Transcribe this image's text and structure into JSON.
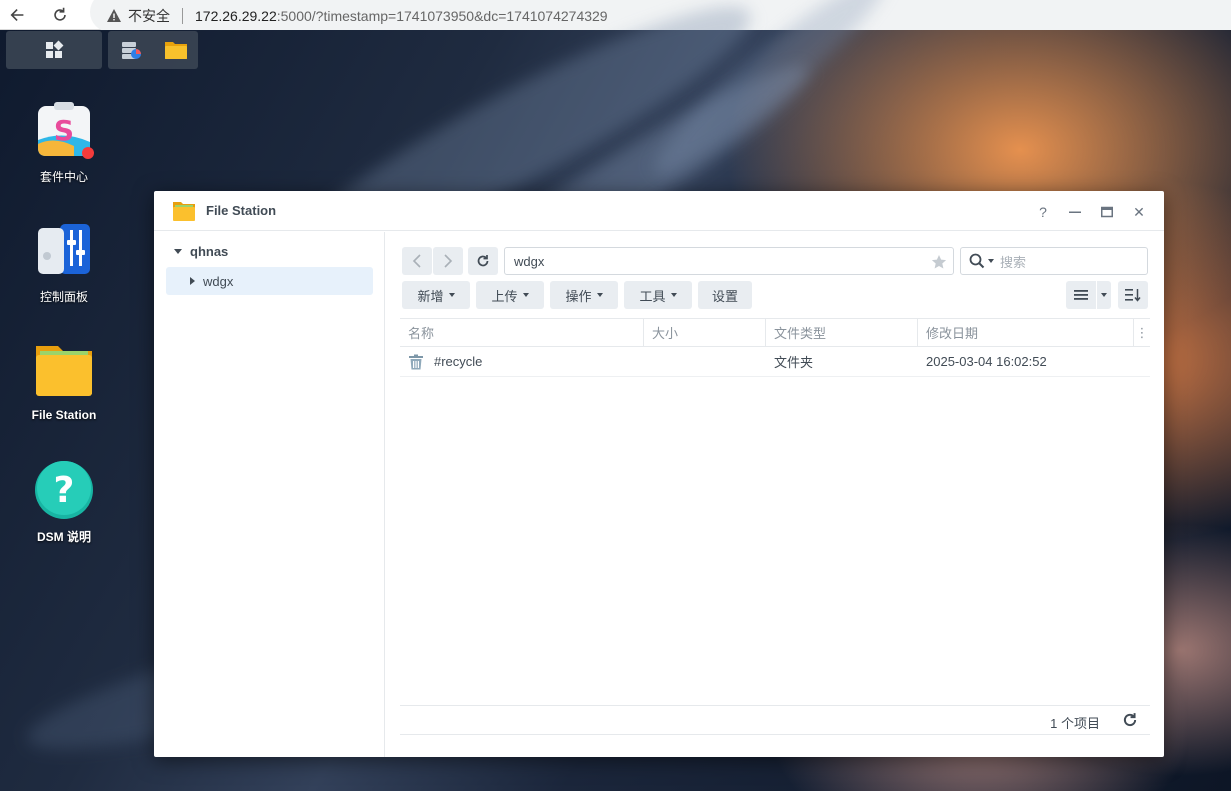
{
  "browser": {
    "back_icon": "arrow-left-icon",
    "reload_icon": "reload-icon",
    "security_label": "不安全",
    "url_host": "172.26.29.22",
    "url_rest": ":5000/?timestamp=1741073950&dc=1741074274329"
  },
  "desktop": {
    "icons": [
      {
        "label": "套件中心",
        "icon": "package-center-icon"
      },
      {
        "label": "控制面板",
        "icon": "control-panel-icon"
      },
      {
        "label": "File Station",
        "icon": "folder-icon"
      },
      {
        "label": "DSM 说明",
        "icon": "help-icon"
      }
    ]
  },
  "window": {
    "title": "File Station",
    "controls": [
      "help-icon",
      "minimize-icon",
      "maximize-icon",
      "close-icon"
    ],
    "help_glyph": "?",
    "close_glyph": "✕"
  },
  "sidebar": {
    "root": "qhnas",
    "child": "wdgx"
  },
  "toolbar": {
    "path": "wdgx",
    "search_placeholder": "搜索",
    "buttons": {
      "new": "新增",
      "upload": "上传",
      "action": "操作",
      "tools": "工具",
      "settings": "设置"
    }
  },
  "table": {
    "columns": [
      "名称",
      "大小",
      "文件类型",
      "修改日期"
    ],
    "rows": [
      {
        "name": "#recycle",
        "size": "",
        "type": "文件夹",
        "modified": "2025-03-04 16:02:52",
        "icon": "trash-icon"
      }
    ]
  },
  "footer": {
    "count": "1 个项目"
  },
  "colors": {
    "accent": "#0086e5",
    "folder": "#f8b626"
  }
}
